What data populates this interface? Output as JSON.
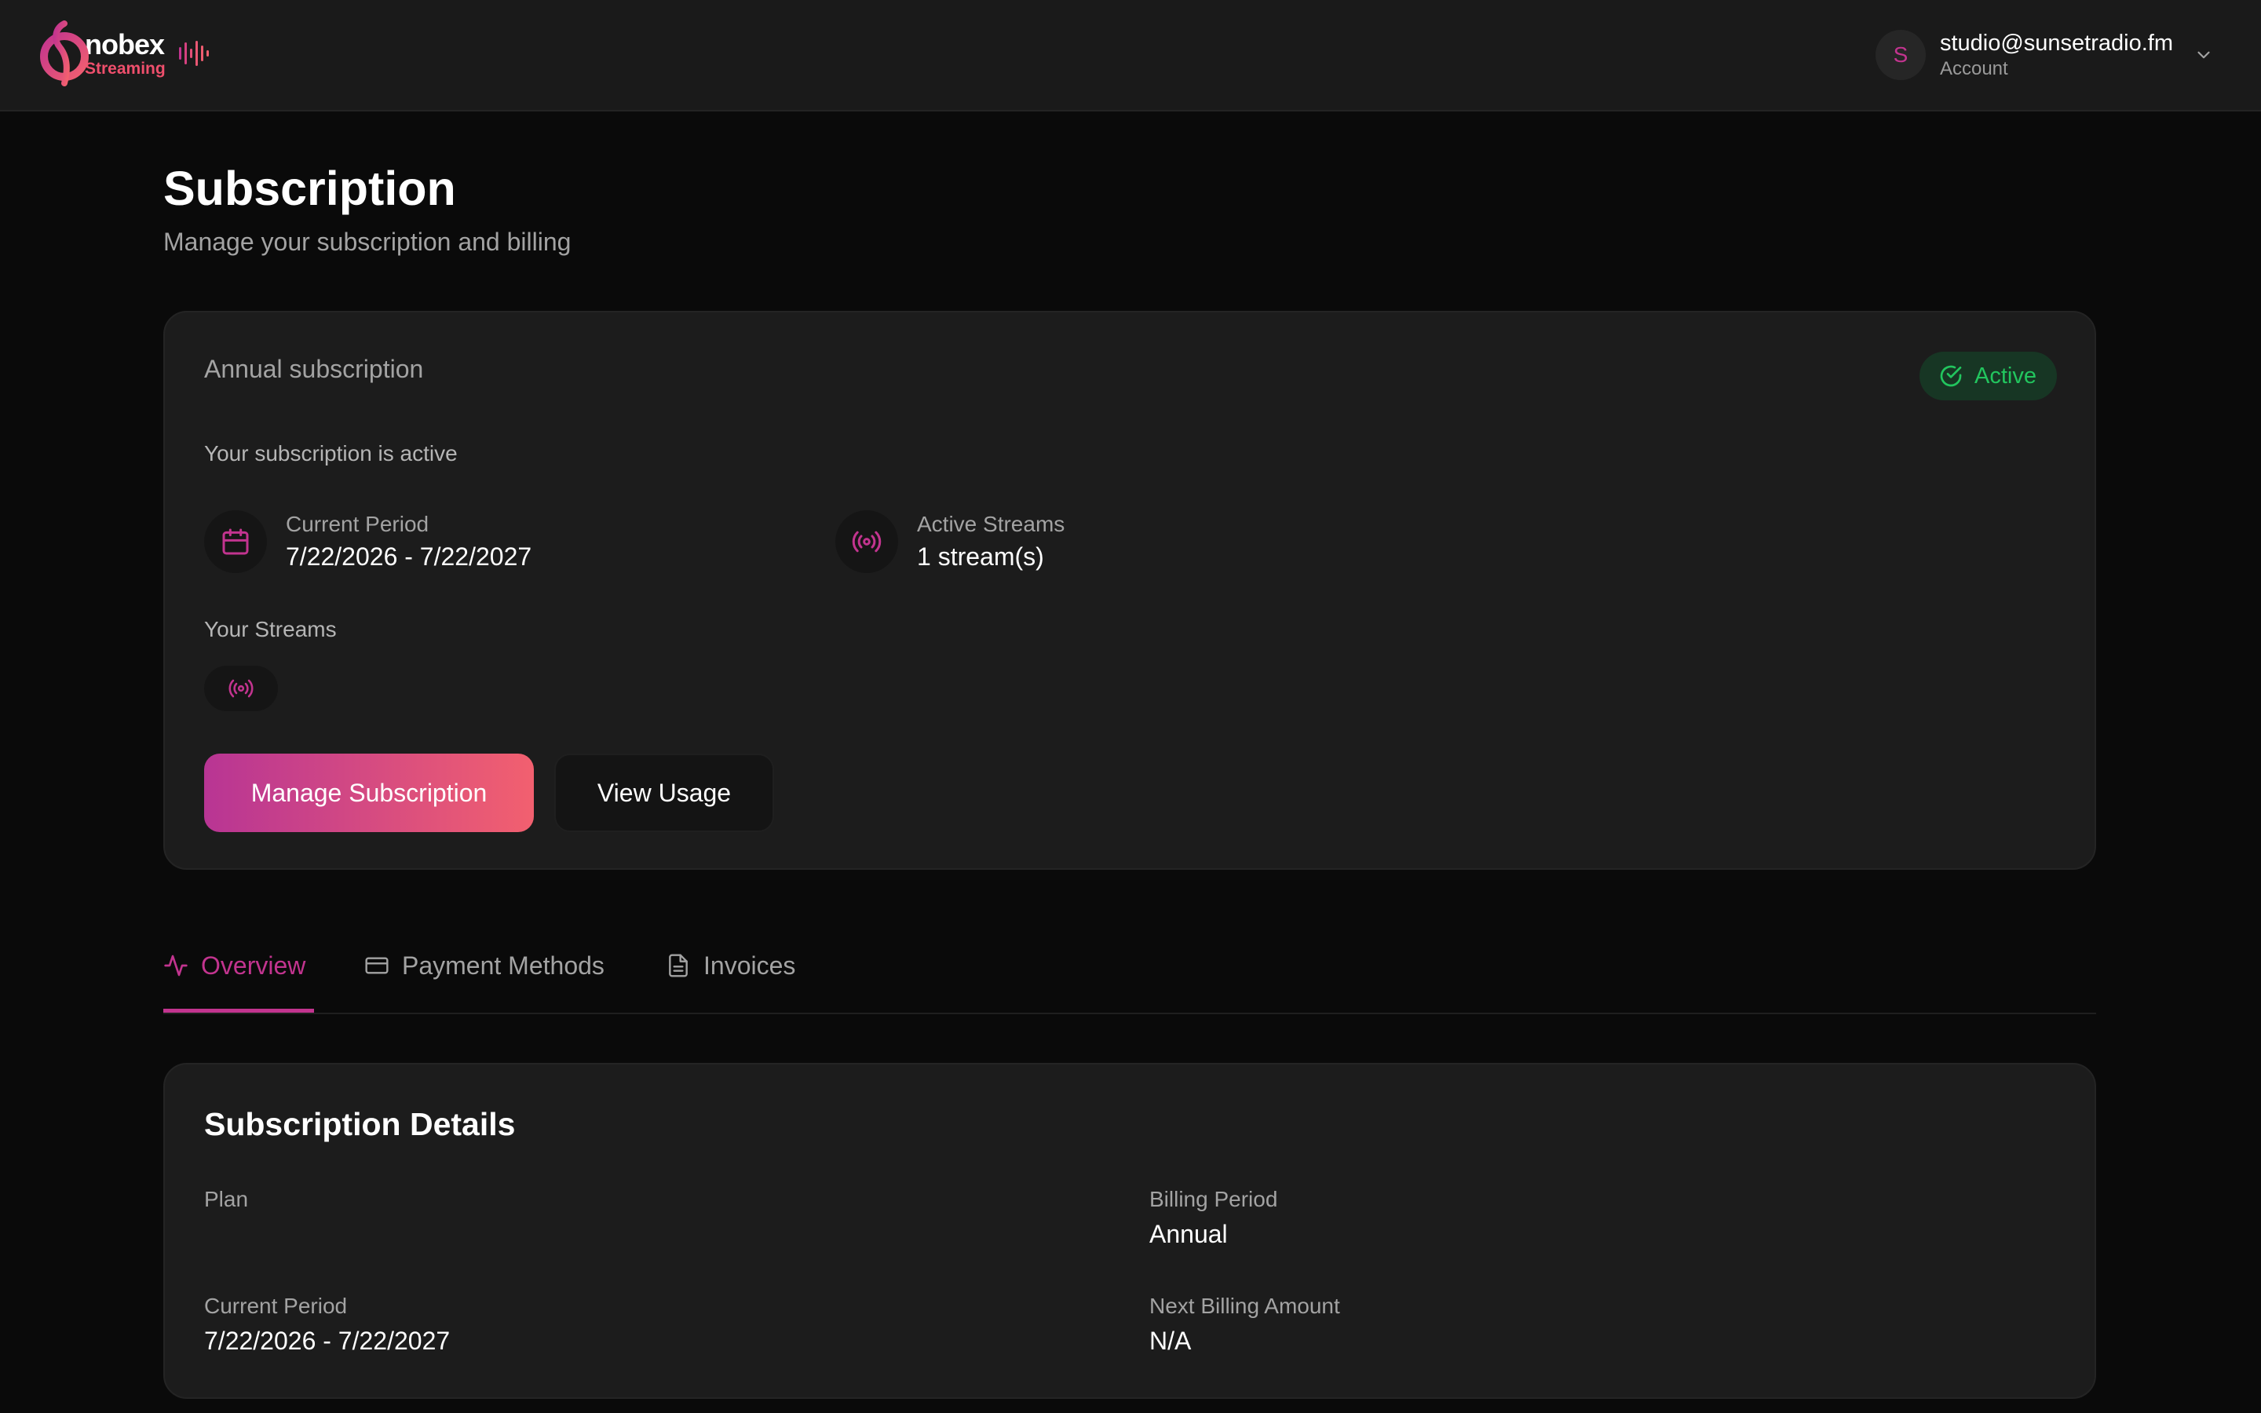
{
  "brand": {
    "name": "nobex",
    "sub": "Streaming",
    "colors": {
      "pink": "#c2348f",
      "coral": "#f2606f",
      "active_green": "#22c55e"
    }
  },
  "account": {
    "avatar_initial": "S",
    "email": "studio@sunsetradio.fm",
    "label": "Account",
    "menu_icon": "chevron-down-icon"
  },
  "page": {
    "title": "Subscription",
    "subtitle": "Manage your subscription and billing"
  },
  "subscription": {
    "plan_label": "Annual subscription",
    "status_badge": "Active",
    "status_line": "Your subscription is active",
    "current_period": {
      "label": "Current Period",
      "value": "7/22/2026 - 7/22/2027",
      "icon": "calendar-icon"
    },
    "active_streams": {
      "label": "Active Streams",
      "value": "1 stream(s)",
      "icon": "broadcast-icon"
    },
    "streams_title": "Your Streams",
    "buttons": {
      "manage": "Manage Subscription",
      "usage": "View Usage"
    }
  },
  "tabs": [
    {
      "label": "Overview",
      "icon": "activity-icon",
      "active": true
    },
    {
      "label": "Payment Methods",
      "icon": "credit-card-icon",
      "active": false
    },
    {
      "label": "Invoices",
      "icon": "document-icon",
      "active": false
    }
  ],
  "details": {
    "title": "Subscription Details",
    "plan": {
      "label": "Plan",
      "value": ""
    },
    "billing_period": {
      "label": "Billing Period",
      "value": "Annual"
    },
    "current_period": {
      "label": "Current Period",
      "value": "7/22/2026 - 7/22/2027"
    },
    "next_billing": {
      "label": "Next Billing Amount",
      "value": "N/A"
    }
  }
}
